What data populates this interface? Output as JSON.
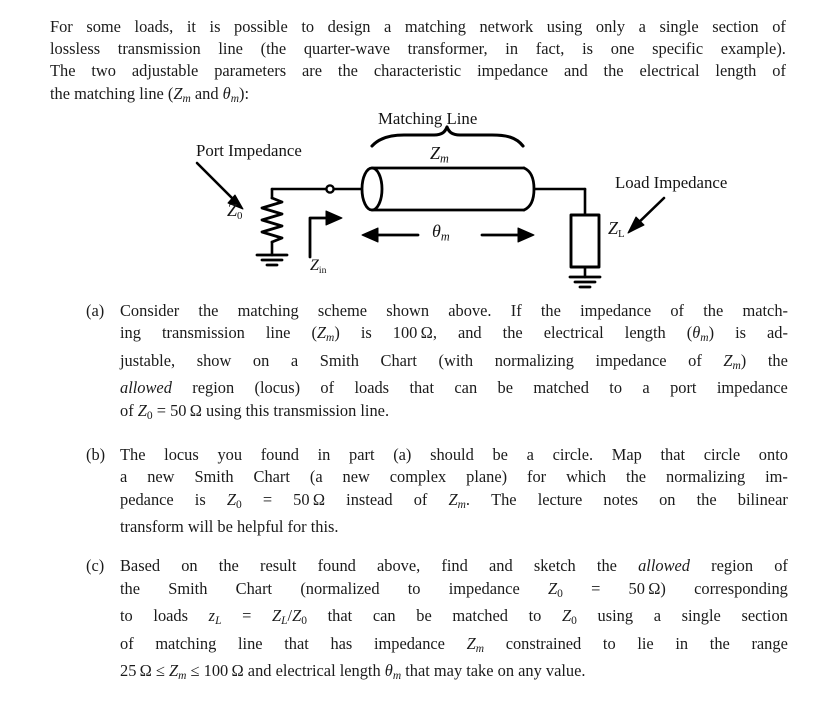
{
  "document": {
    "intro": {
      "lines": [
        [
          "For some loads, it is possible to design a matching network using only a single section of"
        ],
        [
          "lossless transmission line (the quarter-wave transformer, in fact, is one specific example)."
        ],
        [
          "The two adjustable parameters are the characteristic impedance and the electrical length of"
        ],
        [
          "the matching line (Zm and θm):"
        ]
      ],
      "line1_words": [
        "For",
        "some",
        "loads,",
        "it",
        "is",
        "possible",
        "to",
        "design",
        "a",
        "matching",
        "network",
        "using",
        "only",
        "a",
        "single",
        "section",
        "of"
      ],
      "line2_words": [
        "lossless",
        "transmission",
        "line",
        "(the",
        "quarter-wave",
        "transformer,",
        "in",
        "fact,",
        "is",
        "one",
        "specific",
        "example)."
      ],
      "line3_words": [
        "The",
        "two",
        "adjustable",
        "parameters",
        "are",
        "the",
        "characteristic",
        "impedance",
        "and",
        "the",
        "electrical",
        "length",
        "of"
      ],
      "line4_prefix": "the matching line (",
      "line4_mid": " and ",
      "line4_suffix": "):",
      "sym_Zm_Z": "Z",
      "sym_Zm_sub": "m",
      "sym_theta": "θ",
      "sym_theta_sub": "m"
    },
    "diagram": {
      "title": "Matching Line",
      "zm_label_Z": "Z",
      "zm_label_sub": "m",
      "port_impedance_label": "Port Impedance",
      "load_impedance_label": "Load Impedance",
      "z0_Z": "Z",
      "z0_sub": "0",
      "zin_Z": "Z",
      "zin_sub": "in",
      "zl_Z": "Z",
      "zl_sub": "L",
      "theta_sym": "θ",
      "theta_sub": "m",
      "stroke_color": "#000000"
    },
    "questions": [
      {
        "marker": "(a)",
        "lines": [
          {
            "words": [
              "Consider",
              "the",
              "matching",
              "scheme",
              "shown",
              "above.",
              " ",
              "If",
              "the",
              "impedance",
              "of",
              "the",
              "match-"
            ],
            "justify": true
          },
          {
            "text": "ing transmission line (Zm) is 100Ω, and the electrical length (θm) is ad-",
            "justify": true
          },
          {
            "text": "justable, show on a Smith Chart (with normalizing impedance of Zm) the",
            "justify": true
          },
          {
            "words": [
              "allowed",
              "region",
              "(locus)",
              "of",
              "loads",
              "that",
              "can",
              "be",
              "matched",
              "to",
              "a",
              "port",
              "impedance"
            ],
            "justify": true
          },
          {
            "text": "of Z0 = 50Ω using this transmission line.",
            "justify": false
          }
        ]
      },
      {
        "marker": "(b)",
        "lines": [
          {
            "words": [
              "The",
              "locus",
              "you",
              "found",
              "in",
              "part",
              "(a)",
              "should",
              "be",
              "a",
              "circle.",
              " ",
              "Map",
              "that",
              "circle",
              "onto"
            ],
            "justify": true
          },
          {
            "words": [
              "a",
              "new",
              "Smith",
              "Chart",
              "(a",
              "new",
              "complex",
              "plane)",
              "for",
              "which",
              "the",
              "normalizing",
              "im-"
            ],
            "justify": true
          },
          {
            "text": "pedance is Z0 = 50 Ω instead of Zm. The lecture notes on the bilinear",
            "justify": true
          },
          {
            "text": "transform will be helpful for this.",
            "justify": false
          }
        ]
      },
      {
        "marker": "(c)",
        "lines": [
          {
            "words": [
              "Based",
              "on",
              "the",
              "result",
              "found",
              "above,",
              "find",
              "and",
              "sketch",
              "the",
              "allowed",
              "region",
              "of"
            ],
            "justify": true
          },
          {
            "text": "the Smith Chart (normalized to impedance Z0 = 50Ω) corresponding",
            "justify": true
          },
          {
            "text": "to loads zL = ZL/Z0 that can be matched to Z0 using a single section",
            "justify": true
          },
          {
            "words": [
              "of",
              "matching",
              "line",
              "that",
              "has",
              "impedance",
              "Zm",
              "constrained",
              "to",
              "lie",
              "in",
              "the",
              "range"
            ],
            "justify": true
          },
          {
            "text": "25 Ω ≤ Zm ≤ 100 Ω and electrical length θm that may take on any value.",
            "justify": false
          }
        ]
      }
    ],
    "symbols": {
      "ohm": "Ω",
      "leq": "≤",
      "equals": "=",
      "value_zm_a": "100",
      "value_z0": "50",
      "value_zm_min": "25",
      "value_zm_max": "100"
    }
  }
}
